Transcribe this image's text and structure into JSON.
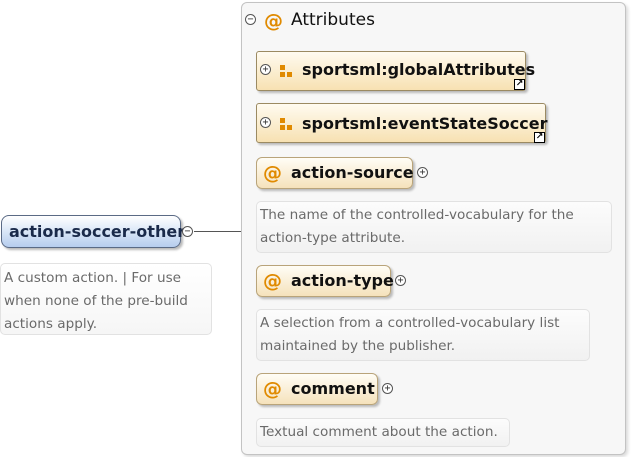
{
  "root": {
    "label": "action-soccer-other",
    "description_lines": [
      "A custom action. | For use",
      "when none of the pre-build",
      "actions apply."
    ]
  },
  "attributes_group": {
    "title": "Attributes",
    "collapse_toggle": "−",
    "refs": [
      {
        "label": "sportsml:globalAttributes",
        "toggle": "+",
        "link_glyph": "↗"
      },
      {
        "label": "sportsml:eventStateSoccer",
        "toggle": "+",
        "link_glyph": "↗"
      }
    ],
    "attributes": [
      {
        "name": "action-source",
        "toggle": "+",
        "description_lines": [
          "The name of the controlled-vocabulary for the",
          "action-type attribute."
        ]
      },
      {
        "name": "action-type",
        "toggle": "+",
        "description_lines": [
          "A selection from a controlled-vocabulary list",
          "maintained by the publisher."
        ]
      },
      {
        "name": "comment",
        "toggle": "+",
        "description_lines": [
          "Textual comment about the action."
        ]
      }
    ]
  },
  "root_toggle": "−",
  "at_symbol": "@",
  "colors": {
    "accent_orange": "#e08a00",
    "root_fill": "#b6cdee",
    "attr_fill": "#f5e2bb",
    "description_text": "#6a6a6a"
  },
  "icons": [
    "collapse-icon",
    "expand-icon",
    "attribute-group-icon",
    "link-arrow-icon",
    "attribute-at-icon"
  ]
}
